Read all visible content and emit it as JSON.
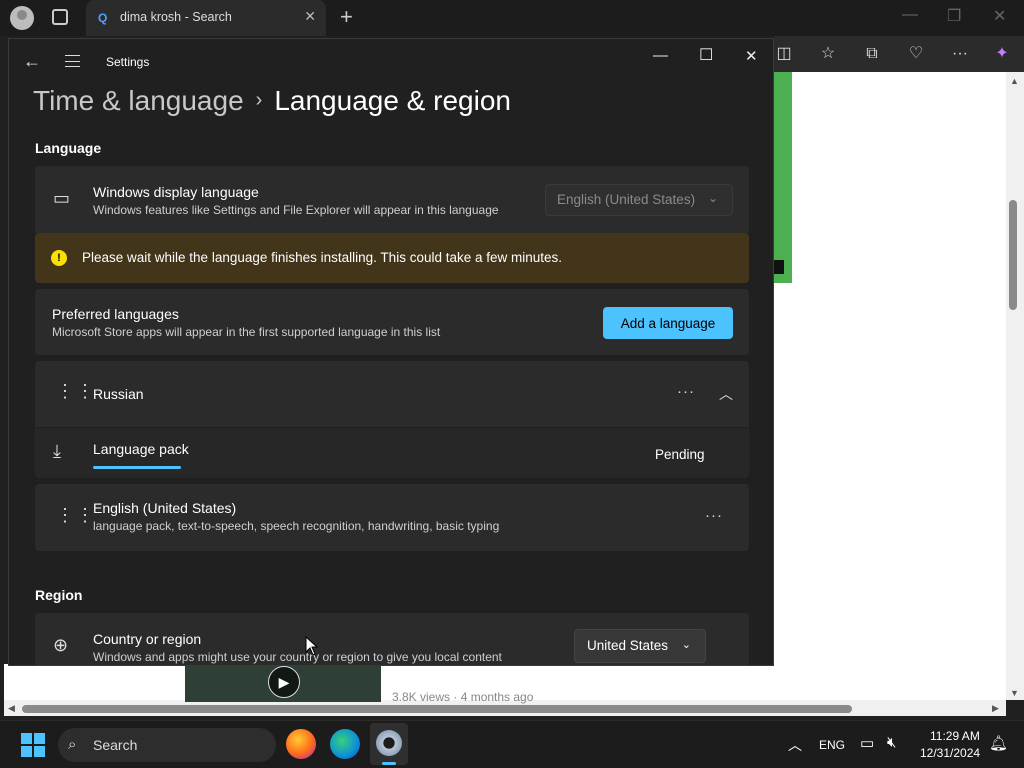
{
  "browser": {
    "tab_title": "dima krosh - Search",
    "tab_close": "✕",
    "new_tab": "+",
    "views_text": "3.8K views · 4 months ago"
  },
  "settings": {
    "window_title": "Settings",
    "breadcrumb": {
      "parent": "Time & language",
      "separator": "›",
      "current": "Language & region"
    },
    "language_section": "Language",
    "display_language": {
      "title": "Windows display language",
      "subtitle": "Windows features like Settings and File Explorer will appear in this language",
      "value": "English (United States)"
    },
    "warning": "Please wait while the language finishes installing. This could take a few minutes.",
    "preferred": {
      "title": "Preferred languages",
      "subtitle": "Microsoft Store apps will appear in the first supported language in this list",
      "add_button": "Add a language"
    },
    "languages": [
      {
        "name": "Russian",
        "expanded": true,
        "sub": {
          "label": "Language pack",
          "status": "Pending",
          "progress": 0.15
        }
      },
      {
        "name": "English (United States)",
        "features": "language pack, text-to-speech, speech recognition, handwriting, basic typing"
      }
    ],
    "region_section": "Region",
    "country": {
      "title": "Country or region",
      "subtitle": "Windows and apps might use your country or region to give you local content",
      "value": "United States"
    }
  },
  "taskbar": {
    "search_label": "Search",
    "language": "ENG",
    "time": "11:29 AM",
    "date": "12/31/2024"
  },
  "colors": {
    "accent": "#4cc2ff",
    "warning_bg": "#433519",
    "warning_icon": "#fce100"
  }
}
